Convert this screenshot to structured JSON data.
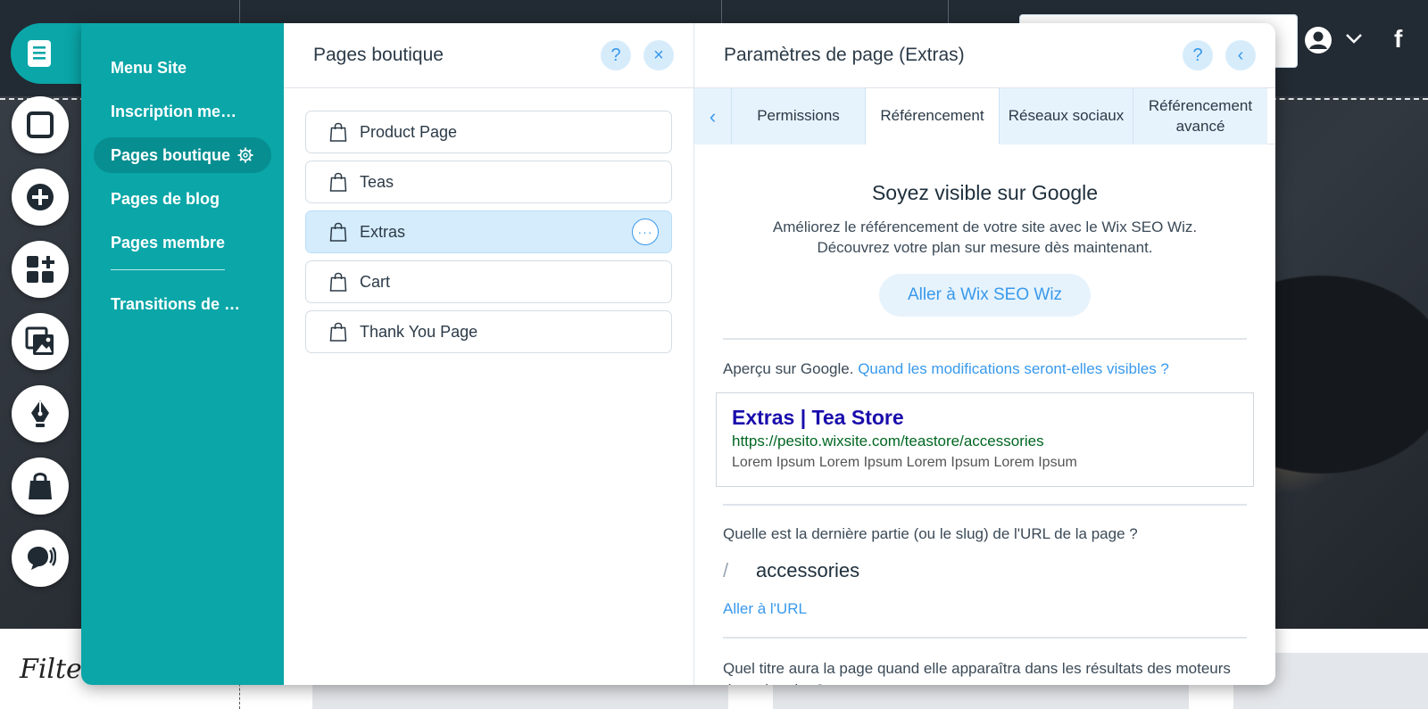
{
  "site": {
    "bottom_title": "Filte",
    "facebook_label": "f"
  },
  "menu": {
    "items": [
      {
        "label": "Menu Site"
      },
      {
        "label": "Inscription membre"
      },
      {
        "label": "Pages boutique"
      },
      {
        "label": "Pages de blog"
      },
      {
        "label": "Pages membre"
      },
      {
        "label": "Transitions de Page"
      }
    ]
  },
  "pages_panel": {
    "title": "Pages boutique",
    "help_label": "?",
    "close_label": "×",
    "pages": [
      {
        "label": "Product Page"
      },
      {
        "label": "Teas"
      },
      {
        "label": "Extras"
      },
      {
        "label": "Cart"
      },
      {
        "label": "Thank You Page"
      }
    ],
    "more_label": "···"
  },
  "settings": {
    "title": "Paramètres de page (Extras)",
    "help_label": "?",
    "back_label": "‹",
    "tab_prev_label": "‹",
    "tabs": [
      {
        "label": "Permissions"
      },
      {
        "label": "Référencement"
      },
      {
        "label": "Réseaux sociaux"
      },
      {
        "label": "Référencement avancé"
      }
    ],
    "seo_title": "Soyez visible sur Google",
    "seo_desc_line1": "Améliorez le référencement de votre site avec le Wix SEO Wiz.",
    "seo_desc_line2": "Découvrez votre plan sur mesure dès maintenant.",
    "seo_button": "Aller à Wix SEO Wiz",
    "preview_label": "Aperçu sur Google.",
    "preview_link": "Quand les modifications seront-elles visibles ?",
    "google_preview": {
      "title": "Extras | Tea Store",
      "url": "https://pesito.wixsite.com/teastore/accessories",
      "description": "Lorem Ipsum Lorem Ipsum Lorem Ipsum Lorem Ipsum"
    },
    "slug_question": "Quelle est la dernière partie (ou le slug) de l'URL de la page ?",
    "slug_prefix": "/",
    "slug_value": "accessories",
    "slug_link": "Aller à l'URL",
    "title_question": "Quel titre aura la page quand elle apparaîtra dans les résultats des moteurs de recherche ?"
  },
  "colors": {
    "teal": "#0aa6a8",
    "teal_dark": "#078e90",
    "accent_blue": "#3899ec",
    "light_blue": "#d5ecfc",
    "google_title": "#1a0dab",
    "google_url": "#006621"
  }
}
